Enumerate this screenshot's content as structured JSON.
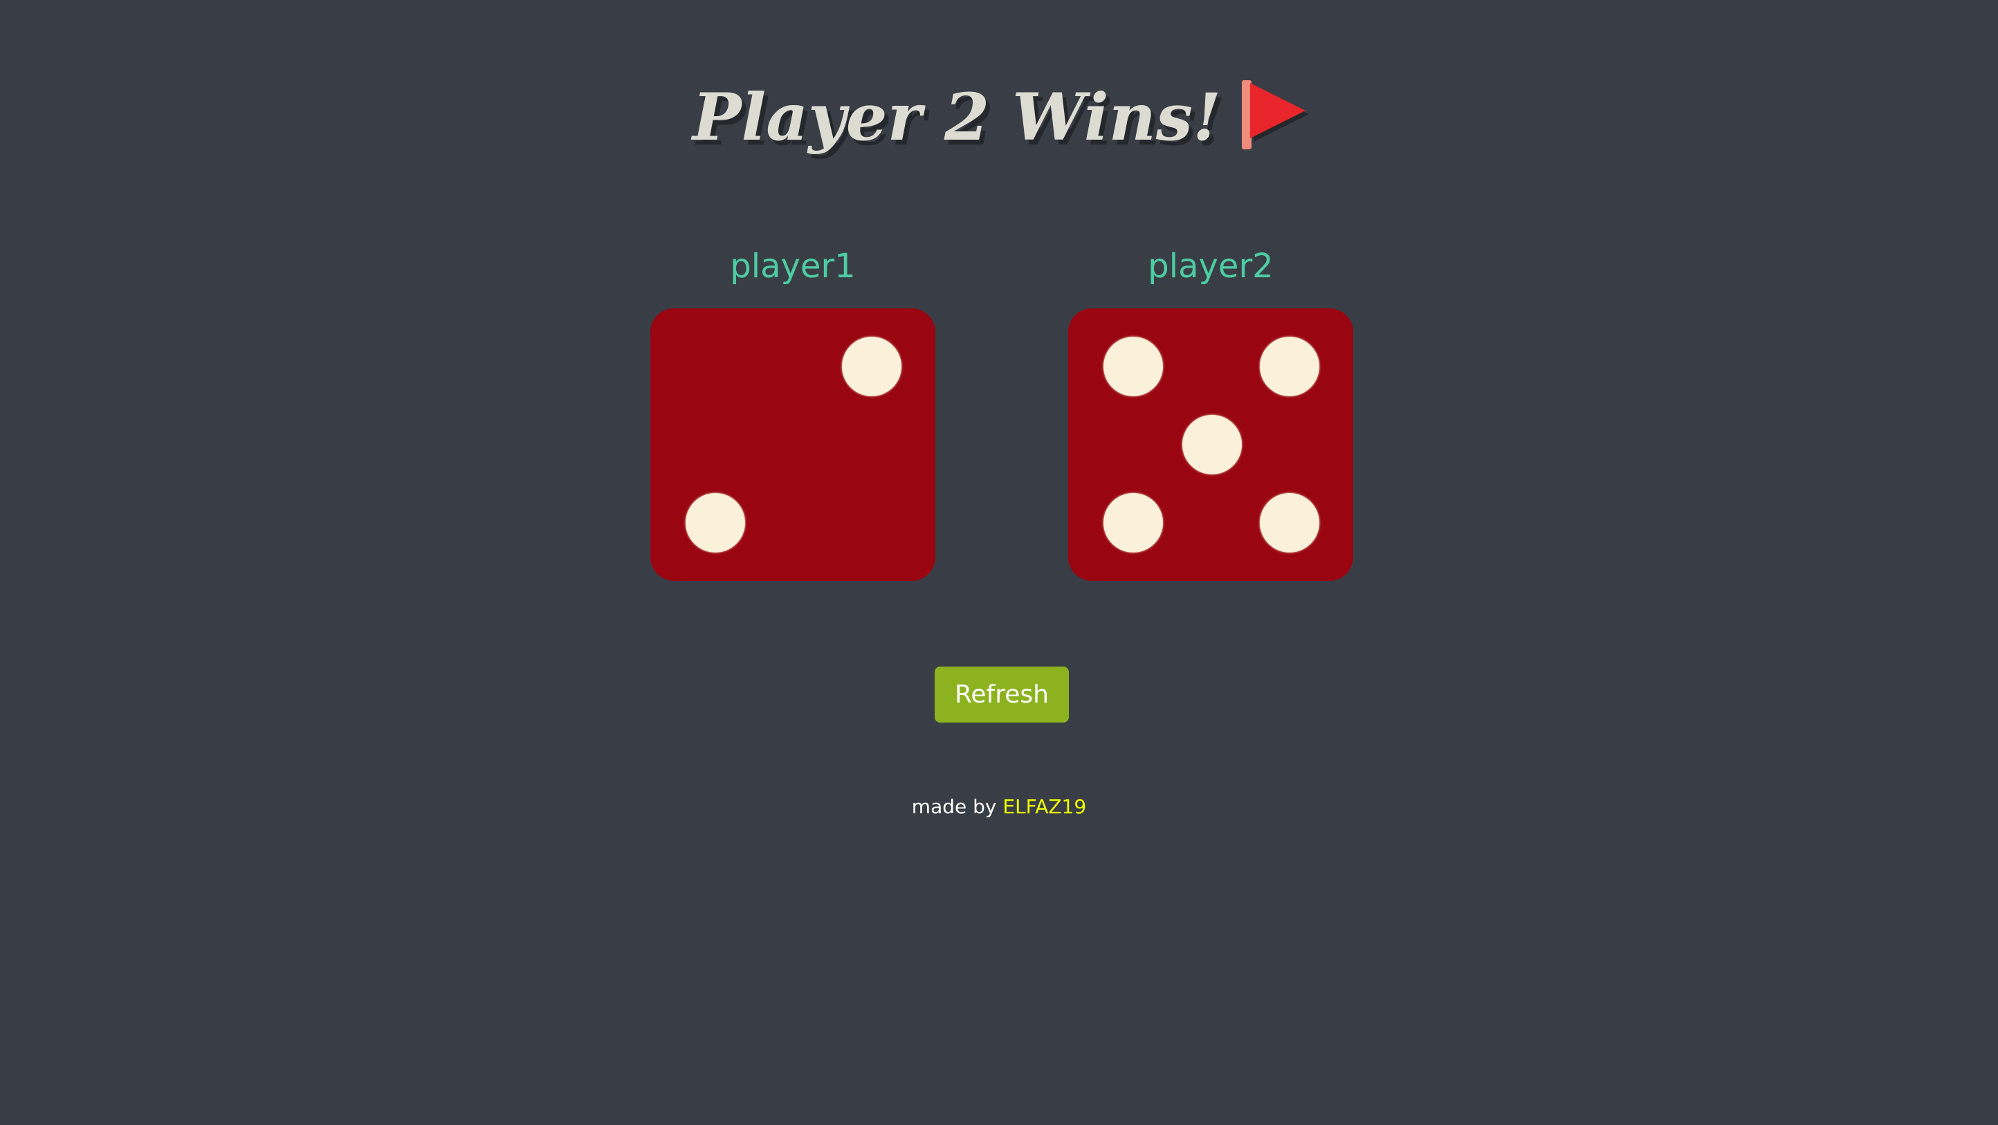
{
  "title": {
    "text": "Player 2 Wins!",
    "icon": "red-flag-icon"
  },
  "players": [
    {
      "label": "player1",
      "die_value": 2
    },
    {
      "label": "player2",
      "die_value": 5
    }
  ],
  "refresh_button": {
    "label": "Refresh"
  },
  "footer": {
    "prefix": "made by",
    "author": "ELFAZ19"
  },
  "colors": {
    "background": "#393E46",
    "title": "#DCDCD3",
    "player_label": "#4ECCA3",
    "die_face": "#990510",
    "die_pip": "#FBF0D9",
    "button": "#8DB21F",
    "author": "#EEFF00"
  }
}
